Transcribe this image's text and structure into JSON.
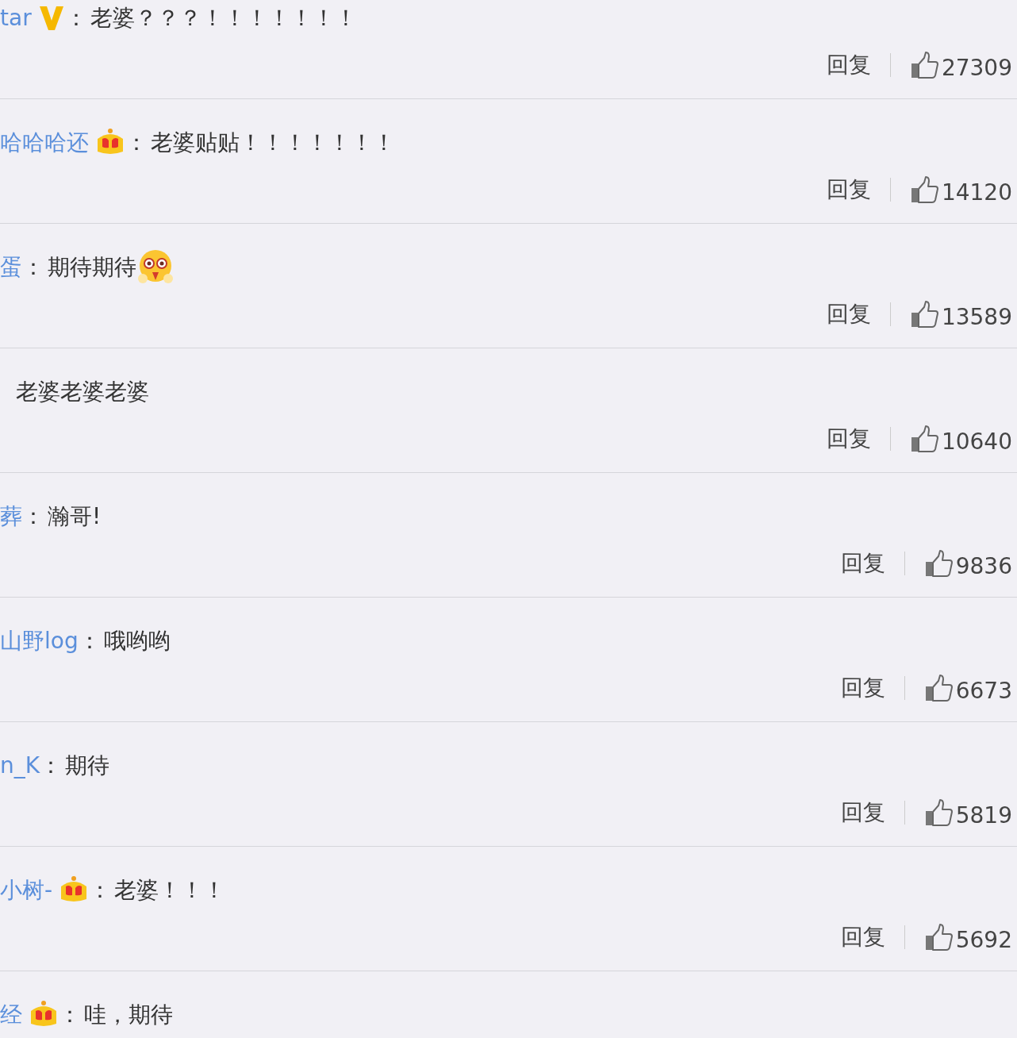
{
  "comments": [
    {
      "user": "tar",
      "kind": "v",
      "separator": "：",
      "text": "老婆？？？！！！！！！！",
      "emoji": false,
      "reply": "回复",
      "likes": "27309"
    },
    {
      "user": "哈哈哈还",
      "kind": "crown",
      "separator": "：",
      "text": "老婆贴贴！！！！！！！",
      "emoji": false,
      "reply": "回复",
      "likes": "14120"
    },
    {
      "user": "蛋",
      "kind": "plain",
      "separator": "：",
      "text": "期待期待",
      "emoji": true,
      "reply": "回复",
      "likes": "13589"
    },
    {
      "kind": "plain",
      "text": "老婆老婆老婆",
      "emoji": false,
      "reply": "回复",
      "likes": "10640"
    },
    {
      "user": "葬",
      "kind": "plain",
      "separator": "：",
      "text": "瀚哥!",
      "emoji": false,
      "reply": "回复",
      "likes": "9836"
    },
    {
      "user": "山野log",
      "kind": "plain",
      "separator": "：",
      "text": "哦哟哟",
      "emoji": false,
      "reply": "回复",
      "likes": "6673"
    },
    {
      "user": "n_K",
      "kind": "plain",
      "separator": "：",
      "text": "期待",
      "emoji": false,
      "reply": "回复",
      "likes": "5819"
    },
    {
      "user": "小树-",
      "kind": "crown",
      "separator": "：",
      "text": "老婆！！！",
      "emoji": false,
      "reply": "回复",
      "likes": "5692"
    },
    {
      "user": "经",
      "kind": "crown",
      "separator": "：",
      "text": "哇，期待",
      "emoji": false
    }
  ]
}
